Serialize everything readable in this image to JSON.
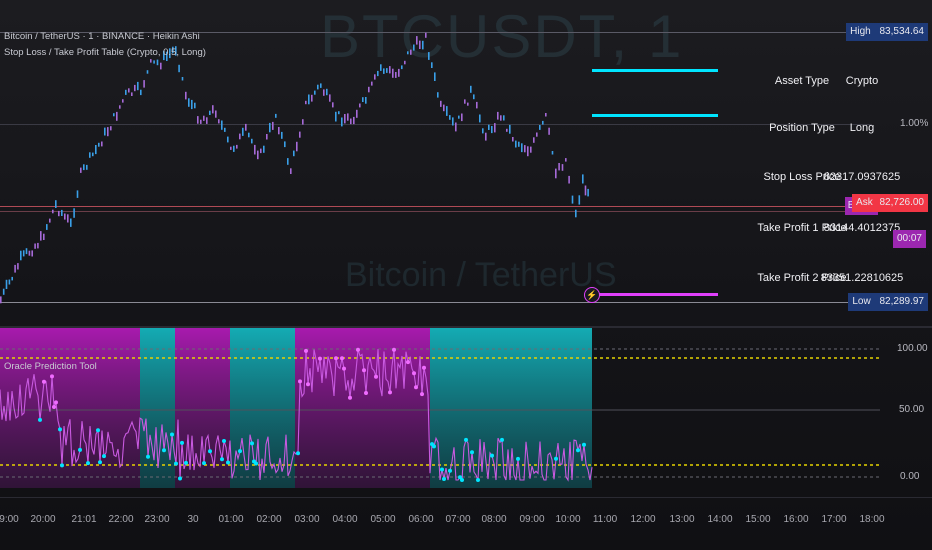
{
  "watermark": {
    "symbol": "BTCUSDT, 1",
    "name": "Bitcoin / TetherUS"
  },
  "legend": {
    "main_title": "Bitcoin / TetherUS · 1 · BINANCE · Heikin Ashi",
    "indicator": "Stop Loss / Take Profit Table (Crypto, 0.5, Long)",
    "oscillator": "Oracle Prediction Tool"
  },
  "price_axis": {
    "high_label": "High",
    "high_value": "83,534.64",
    "pct": "1.00%",
    "symbol_tag": "BTCU",
    "ask_label": "Ask",
    "ask_value": "82,726.00",
    "countdown": "00:07",
    "low_label": "Low",
    "low_value": "82,289.97"
  },
  "table": {
    "rows": [
      {
        "label": "Asset Type",
        "value": "Crypto"
      },
      {
        "label": "Position Type",
        "value": "Long"
      },
      {
        "label": "Stop Loss Price",
        "value": "82317.0937625"
      },
      {
        "label": "Take Profit 1 Price",
        "value": "83144.4012375"
      },
      {
        "label": "Take Profit 2 Price",
        "value": "83351.22810625"
      }
    ]
  },
  "osc_axis": {
    "top": "100.00",
    "mid": "50.00",
    "bottom": "0.00"
  },
  "time_axis": [
    "9:00",
    "20:00",
    "21:01",
    "22:00",
    "23:00",
    "30",
    "01:00",
    "02:00",
    "03:00",
    "04:00",
    "05:00",
    "06:00",
    "07:00",
    "08:00",
    "09:00",
    "10:00",
    "11:00",
    "12:00",
    "13:00",
    "14:00",
    "15:00",
    "16:00",
    "17:00",
    "18:00"
  ],
  "colors": {
    "cyan": "#00e5ff",
    "magenta": "#e040fb",
    "high_tag": "#1e3a78",
    "ask_tag": "#f23645",
    "countdown_tag": "#9c27b0",
    "low_tag": "#1e3a78",
    "guide_yellow": "#e6d300"
  }
}
